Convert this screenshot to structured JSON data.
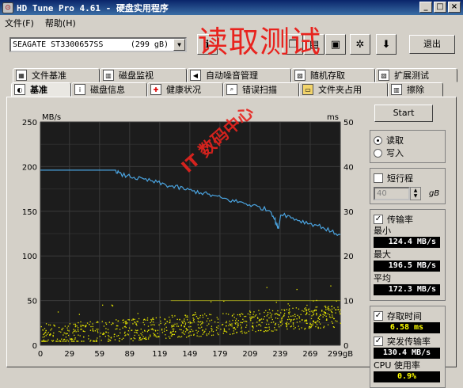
{
  "window": {
    "title": "HD Tune Pro 4.61 - 硬盘实用程序",
    "app_icon": "hdtune-icon"
  },
  "menu": {
    "file": "文件(F)",
    "help": "帮助(H)"
  },
  "toolbar": {
    "drive": "SEAGATE ST3300657SS",
    "capacity": "(299 gB)",
    "exit": "退出"
  },
  "overlay": {
    "title": "读取测试",
    "watermark": "IT 数码中心"
  },
  "tabs_top": [
    "文件基准",
    "磁盘监视",
    "自动噪音管理",
    "随机存取",
    "扩展测试"
  ],
  "tabs_bottom": [
    "基准",
    "磁盘信息",
    "健康状况",
    "错误扫描",
    "文件夹占用",
    "擦除"
  ],
  "chart_data": {
    "type": "line",
    "title": "",
    "xlabel": "",
    "ylabel": "MB/s",
    "y2label": "ms",
    "x_ticks": [
      "0",
      "29",
      "59",
      "89",
      "119",
      "149",
      "179",
      "209",
      "239",
      "269",
      "299gB"
    ],
    "y_ticks": [
      "250",
      "200",
      "150",
      "100",
      "50",
      "0"
    ],
    "y2_ticks": [
      "50",
      "40",
      "30",
      "20",
      "10",
      "0"
    ],
    "xlim": [
      0,
      299
    ],
    "ylim": [
      0,
      250
    ],
    "y2lim": [
      0,
      50
    ],
    "grid": true,
    "series": [
      {
        "name": "传输率",
        "unit": "MB/s",
        "color": "#4aa3df",
        "x": [
          0,
          10,
          20,
          30,
          40,
          50,
          60,
          70,
          75,
          80,
          90,
          100,
          110,
          120,
          130,
          140,
          150,
          160,
          170,
          180,
          190,
          200,
          210,
          220,
          230,
          234,
          237,
          240,
          250,
          260,
          270,
          280,
          290,
          299
        ],
        "y": [
          196,
          196,
          196,
          196,
          196,
          196,
          196,
          196,
          196,
          191,
          189,
          186,
          184,
          181,
          178,
          176,
          173,
          171,
          168,
          165,
          162,
          160,
          157,
          154,
          150,
          140,
          130,
          148,
          143,
          139,
          136,
          133,
          127,
          124
        ]
      },
      {
        "name": "存取时间",
        "unit": "ms",
        "color": "#e6e600",
        "type": "scatter",
        "note_range_ms": [
          1,
          14
        ]
      }
    ]
  },
  "controls": {
    "start": "Start",
    "read": "读取",
    "write": "写入",
    "short_stroke": "短行程",
    "stroke_value": "40",
    "stroke_unit": "gB",
    "transfer_rate": "传输率",
    "min_label": "最小",
    "min_value": "124.4 MB/s",
    "max_label": "最大",
    "max_value": "196.5 MB/s",
    "avg_label": "平均",
    "avg_value": "172.3 MB/s",
    "access_label": "存取时间",
    "access_value": "6.58 ms",
    "burst_label": "突发传输率",
    "burst_value": "130.4 MB/s",
    "cpu_label": "CPU 使用率",
    "cpu_value": "0.9%"
  }
}
